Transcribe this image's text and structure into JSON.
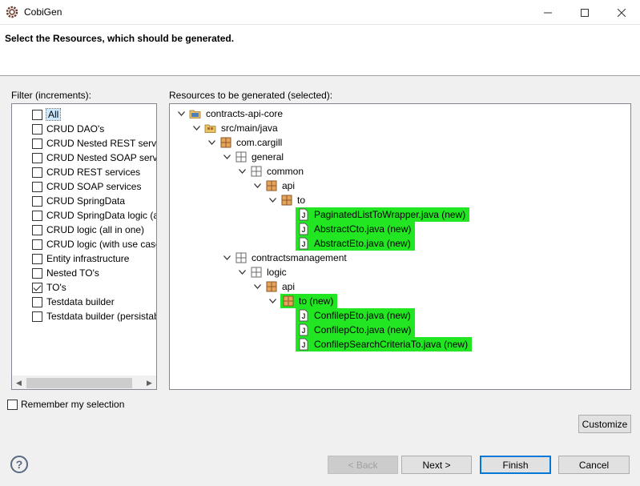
{
  "window": {
    "title": "CobiGen"
  },
  "header": {
    "heading": "Select the Resources, which should be generated."
  },
  "filter": {
    "label": "Filter (increments):",
    "items": [
      {
        "label": "All",
        "checked": false,
        "selected": true
      },
      {
        "label": "CRUD DAO's",
        "checked": false
      },
      {
        "label": "CRUD Nested REST service",
        "checked": false
      },
      {
        "label": "CRUD Nested SOAP servic",
        "checked": false
      },
      {
        "label": "CRUD REST services",
        "checked": false
      },
      {
        "label": "CRUD SOAP services",
        "checked": false
      },
      {
        "label": "CRUD SpringData",
        "checked": false
      },
      {
        "label": "CRUD SpringData logic (al",
        "checked": false
      },
      {
        "label": "CRUD logic (all in one)",
        "checked": false
      },
      {
        "label": "CRUD logic (with use case",
        "checked": false
      },
      {
        "label": "Entity infrastructure",
        "checked": false
      },
      {
        "label": "Nested TO's",
        "checked": false
      },
      {
        "label": "TO's",
        "checked": true
      },
      {
        "label": "Testdata builder",
        "checked": false
      },
      {
        "label": "Testdata builder (persistab",
        "checked": false
      }
    ]
  },
  "resources": {
    "label": "Resources to be generated (selected):",
    "nodes": [
      {
        "label": "contracts-api-core",
        "icon": "project-icon",
        "level": 0,
        "expanded": true
      },
      {
        "label": "src/main/java",
        "icon": "source-folder-icon",
        "level": 1,
        "expanded": true
      },
      {
        "label": "com.cargill",
        "icon": "package-icon",
        "level": 2,
        "expanded": true
      },
      {
        "label": "general",
        "icon": "empty-package-icon",
        "level": 3,
        "expanded": true
      },
      {
        "label": "common",
        "icon": "empty-package-icon",
        "level": 4,
        "expanded": true
      },
      {
        "label": "api",
        "icon": "package-icon",
        "level": 5,
        "expanded": true
      },
      {
        "label": "to",
        "icon": "package-icon",
        "level": 6,
        "expanded": true
      },
      {
        "label": "PaginatedListToWrapper.java (new)",
        "icon": "java-file-icon",
        "level": 7,
        "highlight": true
      },
      {
        "label": "AbstractCto.java (new)",
        "icon": "java-file-icon",
        "level": 7,
        "highlight": true
      },
      {
        "label": "AbstractEto.java (new)",
        "icon": "java-file-icon",
        "level": 7,
        "highlight": true
      },
      {
        "label": "contractsmanagement",
        "icon": "empty-package-icon",
        "level": 3,
        "expanded": true
      },
      {
        "label": "logic",
        "icon": "empty-package-icon",
        "level": 4,
        "expanded": true
      },
      {
        "label": "api",
        "icon": "package-icon",
        "level": 5,
        "expanded": true
      },
      {
        "label": "to (new)",
        "icon": "package-icon",
        "level": 6,
        "expanded": true,
        "highlight": true
      },
      {
        "label": "ConfilepEto.java (new)",
        "icon": "java-file-icon",
        "level": 7,
        "highlight": true
      },
      {
        "label": "ConfilepCto.java (new)",
        "icon": "java-file-icon",
        "level": 7,
        "highlight": true
      },
      {
        "label": "ConfilepSearchCriteriaTo.java (new)",
        "icon": "java-file-icon",
        "level": 7,
        "highlight": true
      }
    ]
  },
  "remember": {
    "label": "Remember my selection",
    "checked": false
  },
  "buttons": {
    "customize": "Customize",
    "back": "< Back",
    "next": "Next >",
    "finish": "Finish",
    "cancel": "Cancel",
    "help": "?"
  },
  "colors": {
    "highlight": "#22e622",
    "accent": "#0078d7"
  }
}
